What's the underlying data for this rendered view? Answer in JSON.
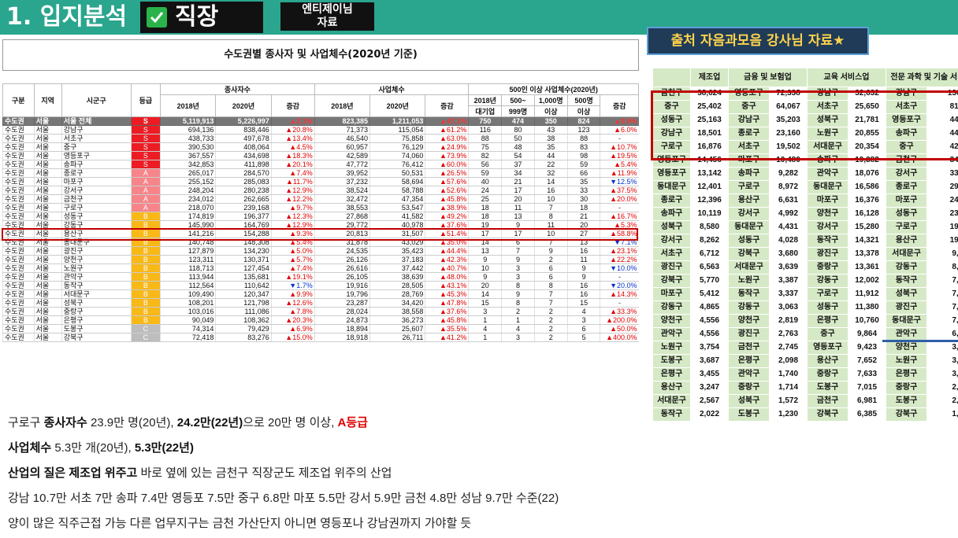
{
  "header": {
    "title": "1. 입지분석",
    "category": "직장",
    "tag_line1": "엔티제이님",
    "tag_line2": "자료"
  },
  "source_banner": "출처 자음과모음 강사님 자료★",
  "main_table": {
    "title": "수도권별 종사자 및 사업체수(2020년 기준)",
    "head": {
      "gubun": "구분",
      "region": "지역",
      "district": "시군구",
      "grade": "등급",
      "workers": "종사자수",
      "firms": "사업체수",
      "large": "500인 이상 사업체수(2020년)",
      "y2018": "2018년",
      "y2020": "2020년",
      "change": "증감",
      "large2018a": "2018년",
      "large2018b": "대기업",
      "l500a": "500~",
      "l500b": "999명",
      "l1000a": "1,000명",
      "l1000b": "이상",
      "l500pa": "500명",
      "l500pb": "이상"
    },
    "rows": [
      [
        "수도권",
        "서울",
        "서울 전체",
        "S",
        "5,119,913",
        "5,226,997",
        "▲2.1%",
        "823,385",
        "1,211,053",
        "▲47.1%",
        "750",
        "474",
        "350",
        "824",
        "▲9.9%"
      ],
      [
        "수도권",
        "서울",
        "강남구",
        "S",
        "694,136",
        "838,446",
        "▲20.8%",
        "71,373",
        "115,054",
        "▲61.2%",
        "116",
        "80",
        "43",
        "123",
        "▲6.0%"
      ],
      [
        "수도권",
        "서울",
        "서초구",
        "S",
        "438,733",
        "497,678",
        "▲13.4%",
        "46,540",
        "75,858",
        "▲63.0%",
        "88",
        "50",
        "38",
        "88",
        "-"
      ],
      [
        "수도권",
        "서울",
        "중구",
        "S",
        "390,530",
        "408,064",
        "▲4.5%",
        "60,957",
        "76,129",
        "▲24.9%",
        "75",
        "48",
        "35",
        "83",
        "▲10.7%"
      ],
      [
        "수도권",
        "서울",
        "영등포구",
        "S",
        "367,557",
        "434,698",
        "▲18.3%",
        "42,589",
        "74,060",
        "▲73.9%",
        "82",
        "54",
        "44",
        "98",
        "▲19.5%"
      ],
      [
        "수도권",
        "서울",
        "송파구",
        "S",
        "342,853",
        "411,898",
        "▲20.1%",
        "47,772",
        "76,412",
        "▲60.0%",
        "56",
        "37",
        "22",
        "59",
        "▲5.4%"
      ],
      [
        "수도권",
        "서울",
        "종로구",
        "A",
        "265,017",
        "284,570",
        "▲7.4%",
        "39,952",
        "50,531",
        "▲26.5%",
        "59",
        "34",
        "32",
        "66",
        "▲11.9%"
      ],
      [
        "수도권",
        "서울",
        "마포구",
        "A",
        "255,152",
        "285,083",
        "▲11.7%",
        "37,232",
        "58,694",
        "▲57.6%",
        "40",
        "21",
        "14",
        "35",
        "▼12.5%"
      ],
      [
        "수도권",
        "서울",
        "강서구",
        "A",
        "248,204",
        "280,238",
        "▲12.9%",
        "38,524",
        "58,788",
        "▲52.6%",
        "24",
        "17",
        "16",
        "33",
        "▲37.5%"
      ],
      [
        "수도권",
        "서울",
        "금천구",
        "A",
        "234,012",
        "262,665",
        "▲12.2%",
        "32,472",
        "47,354",
        "▲45.8%",
        "25",
        "20",
        "10",
        "30",
        "▲20.0%"
      ],
      [
        "수도권",
        "서울",
        "구로구",
        "A",
        "218,070",
        "239,168",
        "▲9.7%",
        "38,553",
        "53,547",
        "▲38.9%",
        "18",
        "11",
        "7",
        "18",
        "-"
      ],
      [
        "수도권",
        "서울",
        "성동구",
        "B",
        "174,819",
        "196,377",
        "▲12.3%",
        "27,868",
        "41,582",
        "▲49.2%",
        "18",
        "13",
        "8",
        "21",
        "▲16.7%"
      ],
      [
        "수도권",
        "서울",
        "강동구",
        "B",
        "145,990",
        "164,769",
        "▲12.9%",
        "29,772",
        "40,978",
        "▲37.6%",
        "19",
        "9",
        "11",
        "20",
        "▲5.3%"
      ],
      [
        "수도권",
        "서울",
        "용산구",
        "B",
        "141,216",
        "154,288",
        "▲9.3%",
        "20,813",
        "31,507",
        "▲51.4%",
        "17",
        "17",
        "10",
        "27",
        "▲58.8%"
      ],
      [
        "수도권",
        "서울",
        "동대문구",
        "B",
        "140,748",
        "148,308",
        "▲5.4%",
        "31,878",
        "43,029",
        "▲35.0%",
        "14",
        "6",
        "7",
        "13",
        "▼7.1%"
      ],
      [
        "수도권",
        "서울",
        "광진구",
        "B",
        "127,879",
        "134,230",
        "▲5.0%",
        "24,535",
        "35,423",
        "▲44.4%",
        "13",
        "7",
        "9",
        "16",
        "▲23.1%"
      ],
      [
        "수도권",
        "서울",
        "양천구",
        "B",
        "123,311",
        "130,371",
        "▲5.7%",
        "26,126",
        "37,183",
        "▲42.3%",
        "9",
        "9",
        "2",
        "11",
        "▲22.2%"
      ],
      [
        "수도권",
        "서울",
        "노원구",
        "B",
        "118,713",
        "127,454",
        "▲7.4%",
        "26,616",
        "37,442",
        "▲40.7%",
        "10",
        "3",
        "6",
        "9",
        "▼10.0%"
      ],
      [
        "수도권",
        "서울",
        "관악구",
        "B",
        "113,944",
        "135,681",
        "▲19.1%",
        "26,105",
        "38,639",
        "▲48.0%",
        "9",
        "3",
        "6",
        "9",
        "-"
      ],
      [
        "수도권",
        "서울",
        "동작구",
        "B",
        "112,564",
        "110,642",
        "▼1.7%",
        "19,916",
        "28,505",
        "▲43.1%",
        "20",
        "8",
        "8",
        "16",
        "▼20.0%"
      ],
      [
        "수도권",
        "서울",
        "서대문구",
        "B",
        "109,490",
        "120,347",
        "▲9.9%",
        "19,796",
        "28,769",
        "▲45.3%",
        "14",
        "9",
        "7",
        "16",
        "▲14.3%"
      ],
      [
        "수도권",
        "서울",
        "성북구",
        "B",
        "108,201",
        "121,798",
        "▲12.6%",
        "23,287",
        "34,420",
        "▲47.8%",
        "15",
        "8",
        "7",
        "15",
        "-"
      ],
      [
        "수도권",
        "서울",
        "중랑구",
        "B",
        "103,016",
        "111,086",
        "▲7.8%",
        "28,024",
        "38,558",
        "▲37.6%",
        "3",
        "2",
        "2",
        "4",
        "▲33.3%"
      ],
      [
        "수도권",
        "서울",
        "은평구",
        "B",
        "90,049",
        "108,362",
        "▲20.3%",
        "24,873",
        "36,273",
        "▲45.8%",
        "1",
        "1",
        "2",
        "3",
        "▲200.0%"
      ],
      [
        "수도권",
        "서울",
        "도봉구",
        "C",
        "74,314",
        "79,429",
        "▲6.9%",
        "18,894",
        "25,607",
        "▲35.5%",
        "4",
        "4",
        "2",
        "6",
        "▲50.0%"
      ],
      [
        "수도권",
        "서울",
        "강북구",
        "C",
        "72,418",
        "83,276",
        "▲15.0%",
        "18,918",
        "26,711",
        "▲41.2%",
        "1",
        "3",
        "2",
        "5",
        "▲400.0%"
      ]
    ]
  },
  "right_table": {
    "headers": [
      "제조업",
      "금융 및 보험업",
      "교육 서비스업",
      "전문 과학 및 기술 서비스업"
    ],
    "rows": [
      [
        "금천구",
        "38,624",
        "영등포구",
        "72,338",
        "강남구",
        "32,632",
        "강남구",
        "136,"
      ],
      [
        "중구",
        "25,402",
        "중구",
        "64,067",
        "서초구",
        "25,650",
        "서초구",
        "81,"
      ],
      [
        "성동구",
        "25,163",
        "강남구",
        "35,203",
        "성북구",
        "21,781",
        "영등포구",
        "44,"
      ],
      [
        "강남구",
        "18,501",
        "종로구",
        "23,160",
        "노원구",
        "20,855",
        "송파구",
        "44,"
      ],
      [
        "구로구",
        "16,876",
        "서초구",
        "19,502",
        "서대문구",
        "20,354",
        "중구",
        "42,"
      ],
      [
        "영등포구",
        "14,456",
        "마포구",
        "10,480",
        "송파구",
        "19,382",
        "금천구",
        "34,"
      ],
      [
        "영등포구",
        "13,142",
        "송파구",
        "9,282",
        "관악구",
        "18,076",
        "강서구",
        "33,"
      ],
      [
        "동대문구",
        "12,401",
        "구로구",
        "8,972",
        "동대문구",
        "16,586",
        "종로구",
        "29,"
      ],
      [
        "종로구",
        "12,396",
        "용산구",
        "6,631",
        "마포구",
        "16,376",
        "마포구",
        "24,"
      ],
      [
        "송파구",
        "10,119",
        "강서구",
        "4,992",
        "양천구",
        "16,128",
        "성동구",
        "23,"
      ],
      [
        "성북구",
        "8,580",
        "동대문구",
        "4,431",
        "강서구",
        "15,280",
        "구로구",
        "19,"
      ],
      [
        "강서구",
        "8,262",
        "성동구",
        "4,028",
        "동작구",
        "14,321",
        "용산구",
        "19,"
      ],
      [
        "서초구",
        "6,712",
        "강북구",
        "3,680",
        "광진구",
        "13,378",
        "서대문구",
        "9,"
      ],
      [
        "광진구",
        "6,563",
        "서대문구",
        "3,639",
        "중랑구",
        "13,361",
        "강동구",
        "8,"
      ],
      [
        "강북구",
        "5,770",
        "노원구",
        "3,387",
        "강동구",
        "12,002",
        "동작구",
        "7,"
      ],
      [
        "마포구",
        "5,412",
        "동작구",
        "3,337",
        "구로구",
        "11,912",
        "성북구",
        "7,"
      ],
      [
        "강동구",
        "4,865",
        "강동구",
        "3,063",
        "성동구",
        "11,380",
        "광진구",
        "7,"
      ],
      [
        "양천구",
        "4,556",
        "양천구",
        "2,819",
        "은평구",
        "10,760",
        "동대문구",
        "7,"
      ],
      [
        "관악구",
        "4,556",
        "광진구",
        "2,763",
        "중구",
        "9,864",
        "관악구",
        "6,"
      ],
      [
        "노원구",
        "3,754",
        "금천구",
        "2,745",
        "영등포구",
        "9,423",
        "양천구",
        "3,"
      ],
      [
        "도봉구",
        "3,687",
        "은평구",
        "2,098",
        "용산구",
        "7,652",
        "노원구",
        "3,"
      ],
      [
        "은평구",
        "3,455",
        "관악구",
        "1,740",
        "중랑구",
        "7,633",
        "은평구",
        "3,"
      ],
      [
        "용산구",
        "3,247",
        "중랑구",
        "1,714",
        "도봉구",
        "7,015",
        "중랑구",
        "2,"
      ],
      [
        "서대문구",
        "2,567",
        "성북구",
        "1,572",
        "금천구",
        "6,981",
        "도봉구",
        "2,"
      ],
      [
        "동작구",
        "2,022",
        "도봉구",
        "1,230",
        "강북구",
        "6,385",
        "강북구",
        "1,"
      ]
    ]
  },
  "notes": {
    "l1": {
      "a": "구로구 ",
      "b": "종사자수",
      "c": " 23.9만 명(20년), ",
      "d": "24.2만(22년)",
      "e": "으로 20만 명 이상, ",
      "f": "A등급"
    },
    "l2": {
      "a": "사업체수",
      "b": " 5.3만 개(20년), ",
      "c": "5.3만(22년)"
    },
    "l3": {
      "a": "산업의 질은 제조업 위주고",
      "b": " 바로 옆에 있는 금천구 직장군도 제조업 위주의 산업"
    },
    "l4": "강남 10.7만 서초 7만 송파 7.4만 영등포 7.5만 중구 6.8만 마포 5.5만 강서 5.9만 금천 4.8만 성남 9.7만 수준(22)",
    "l5": "양이 많은 직주근접 가능 다른 업무지구는 금천 가산단지 아니면 영등포나 강남권까지 가야할 듯"
  },
  "colors": {
    "band": "#2aa58e",
    "grade_S": "#ec1c24",
    "grade_A": "#f6858a",
    "grade_B": "#f8b817",
    "grade_C": "#bdbdbd",
    "highlight": "#c00000"
  }
}
